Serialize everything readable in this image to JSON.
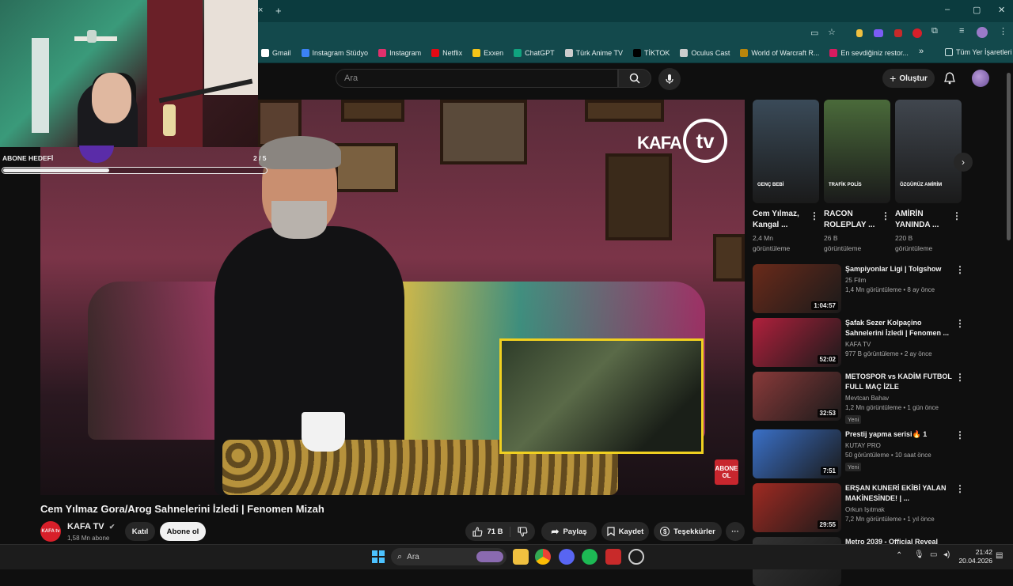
{
  "browser": {
    "bookmarks": [
      {
        "label": "Gmail",
        "color": "#ffffff"
      },
      {
        "label": "Instagram Stüdyo",
        "color": "#3b82f6"
      },
      {
        "label": "Instagram",
        "color": "#e1306c"
      },
      {
        "label": "Netflix",
        "color": "#e50914"
      },
      {
        "label": "Exxen",
        "color": "#f5c518"
      },
      {
        "label": "ChatGPT",
        "color": "#10a37f"
      },
      {
        "label": "Türk Anime TV",
        "color": "#cccccc"
      },
      {
        "label": "TİKTOK",
        "color": "#000000"
      },
      {
        "label": "Oculus Cast",
        "color": "#cccccc"
      },
      {
        "label": "World of Warcraft R...",
        "color": "#b8860b"
      },
      {
        "label": "En sevdiğiniz restor...",
        "color": "#d81b60"
      }
    ],
    "all_bookmarks_label": "Tüm Yer İşaretleri",
    "more_bookmarks": "»",
    "new_tab": "+",
    "close_tab": "×"
  },
  "header": {
    "search_placeholder": "Ara",
    "create_label": "Oluştur"
  },
  "overlay": {
    "goal_label": "ABONE HEDEFİ",
    "goal_count": "2 / 5",
    "goal_progress": 0.4
  },
  "video": {
    "title": "Cem Yılmaz Gora/Arog Sahnelerini İzledi | Fenomen Mizah",
    "logo_text": "KAFA",
    "logo_tv": "tv",
    "corner_badge": "ABONE OL"
  },
  "channel": {
    "name": "KAFA TV",
    "subscribers": "1,58 Mn abone",
    "avatar_text": "KAFA tv",
    "join_label": "Katıl",
    "subscribe_label": "Abone ol"
  },
  "actions": {
    "likes": "71 B",
    "share_label": "Paylaş",
    "save_label": "Kaydet",
    "thanks_label": "Teşekkürler",
    "more": "···"
  },
  "shorts": [
    {
      "title": "Cem Yılmaz, Kangal ...",
      "views": "2,4 Mn",
      "views_unit": "görüntüleme",
      "overlay": "GENÇ BEBİ",
      "thumb_color": "#3a4a58"
    },
    {
      "title": "RACON ROLEPLAY ...",
      "views": "26 B",
      "views_unit": "görüntüleme",
      "overlay": "TRAFİK POLİS",
      "thumb_color": "#4a6a3a"
    },
    {
      "title": "AMİRİN YANINDA ...",
      "views": "220 B",
      "views_unit": "görüntüleme",
      "overlay": "ÖZGÜRÜZ AMİRİM",
      "thumb_color": "#40464e"
    }
  ],
  "recommendations": [
    {
      "title": "Şampiyonlar Ligi | Tolgshow",
      "channel": "25 Film",
      "meta": "1,4 Mn görüntüleme • 8 ay önce",
      "duration": "1:04:57",
      "thumb_color": "#6a2a1a",
      "badge": ""
    },
    {
      "title": "Şafak Sezer Kolpaçino Sahnelerini İzledi | Fenomen ...",
      "channel": "KAFA TV",
      "meta": "977 B görüntüleme • 2 ay önce",
      "duration": "52:02",
      "thumb_color": "#b0203c",
      "badge": ""
    },
    {
      "title": "METOSPOR vs KADİM FUTBOL FULL MAÇ İZLE",
      "channel": "Mevtcan Bahav",
      "meta": "1,2 Mn görüntüleme • 1 gün önce",
      "duration": "32:53",
      "thumb_color": "#8a3a3a",
      "badge": "Yeni"
    },
    {
      "title": "Prestij yapma serisi🔥 1",
      "channel": "KUTAY PRO",
      "meta": "50 görüntüleme • 10 saat önce",
      "duration": "7:51",
      "thumb_color": "#3a70c8",
      "badge": "Yeni"
    },
    {
      "title": "ERŞAN KUNERİ EKİBİ YALAN MAKİNESİNDE! | ...",
      "channel": "Orkun Işıtmak",
      "meta": "7,2 Mn görüntüleme • 1 yıl önce",
      "duration": "29:55",
      "thumb_color": "#a02a22",
      "badge": ""
    },
    {
      "title": "Metro 2039 - Official Reveal",
      "channel": "",
      "meta": "",
      "duration": "",
      "thumb_color": "#333333",
      "badge": ""
    }
  ],
  "taskbar": {
    "search_label": "Ara",
    "time": "21:42",
    "date": "20.04.2026"
  }
}
